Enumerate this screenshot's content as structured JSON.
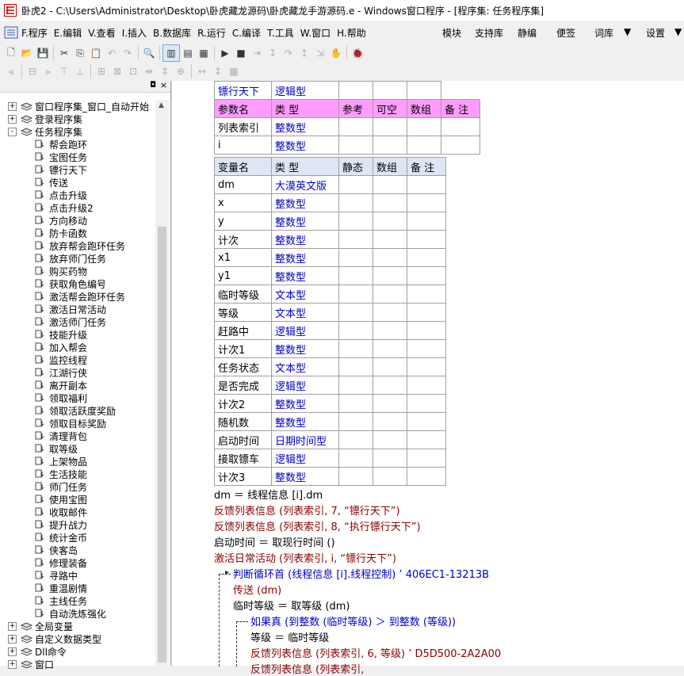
{
  "title": "卧虎2 - C:\\Users\\Administrator\\Desktop\\卧虎藏龙源码\\卧虎藏龙手游源码.e - Windows窗口程序 - [程序集: 任务程序集]",
  "menu": [
    "F.程序",
    "E.编辑",
    "V.查看",
    "I.插入",
    "B.数据库",
    "R.运行",
    "C.编译",
    "T.工具",
    "W.窗口",
    "H.帮助"
  ],
  "menu_right": [
    "模块",
    "支持库",
    "静编",
    "便签",
    "词库",
    "设置"
  ],
  "tree": [
    {
      "label": "窗口程序集_窗口_自动开始",
      "level": 1,
      "expander": "+"
    },
    {
      "label": "登录程序集",
      "level": 1,
      "expander": "+"
    },
    {
      "label": "任务程序集",
      "level": 1,
      "expander": "-"
    },
    {
      "label": "帮会跑环",
      "level": 2
    },
    {
      "label": "宝图任务",
      "level": 2
    },
    {
      "label": "镖行天下",
      "level": 2
    },
    {
      "label": "传送",
      "level": 2
    },
    {
      "label": "点击升级",
      "level": 2
    },
    {
      "label": "点击升级2",
      "level": 2
    },
    {
      "label": "方向移动",
      "level": 2
    },
    {
      "label": "防卡函数",
      "level": 2
    },
    {
      "label": "放弃帮会跑环任务",
      "level": 2
    },
    {
      "label": "放弃师门任务",
      "level": 2
    },
    {
      "label": "购买药物",
      "level": 2
    },
    {
      "label": "获取角色编号",
      "level": 2
    },
    {
      "label": "激活帮会跑环任务",
      "level": 2
    },
    {
      "label": "激活日常活动",
      "level": 2
    },
    {
      "label": "激活师门任务",
      "level": 2
    },
    {
      "label": "技能升级",
      "level": 2
    },
    {
      "label": "加入帮会",
      "level": 2
    },
    {
      "label": "监控线程",
      "level": 2
    },
    {
      "label": "江湖行侠",
      "level": 2
    },
    {
      "label": "离开副本",
      "level": 2
    },
    {
      "label": "领取福利",
      "level": 2
    },
    {
      "label": "领取活跃度奖励",
      "level": 2
    },
    {
      "label": "领取目标奖励",
      "level": 2
    },
    {
      "label": "清理背包",
      "level": 2
    },
    {
      "label": "取等级",
      "level": 2
    },
    {
      "label": "上架物品",
      "level": 2
    },
    {
      "label": "生活技能",
      "level": 2
    },
    {
      "label": "师门任务",
      "level": 2
    },
    {
      "label": "使用宝图",
      "level": 2
    },
    {
      "label": "收取邮件",
      "level": 2
    },
    {
      "label": "提升战力",
      "level": 2
    },
    {
      "label": "统计金币",
      "level": 2
    },
    {
      "label": "侠客岛",
      "level": 2
    },
    {
      "label": "修理装备",
      "level": 2
    },
    {
      "label": "寻路中",
      "level": 2
    },
    {
      "label": "重温剧情",
      "level": 2
    },
    {
      "label": "主线任务",
      "level": 2
    },
    {
      "label": "自动洗炼强化",
      "level": 2
    },
    {
      "label": "全局变量",
      "level": 0,
      "expander": "+"
    },
    {
      "label": "自定义数据类型",
      "level": 0,
      "expander": "+"
    },
    {
      "label": "Dll命令",
      "level": 0,
      "expander": "+"
    },
    {
      "label": "窗口",
      "level": 0,
      "expander": "+"
    }
  ],
  "sub_table": {
    "name": "镖行天下",
    "type": "逻辑型",
    "headers": [
      "参数名",
      "类 型",
      "参考",
      "可空",
      "数组",
      "备 注"
    ],
    "rows": [
      [
        "列表索引",
        "整数型"
      ],
      [
        "i",
        "整数型"
      ]
    ]
  },
  "var_table": {
    "headers": [
      "变量名",
      "类 型",
      "静态",
      "数组",
      "备 注"
    ],
    "rows": [
      [
        "dm",
        "大漠英文版"
      ],
      [
        "x",
        "整数型"
      ],
      [
        "y",
        "整数型"
      ],
      [
        "计次",
        "整数型"
      ],
      [
        "x1",
        "整数型"
      ],
      [
        "y1",
        "整数型"
      ],
      [
        "临时等级",
        "文本型"
      ],
      [
        "等级",
        "文本型"
      ],
      [
        "赶路中",
        "逻辑型"
      ],
      [
        "计次1",
        "整数型"
      ],
      [
        "任务状态",
        "文本型"
      ],
      [
        "是否完成",
        "逻辑型"
      ],
      [
        "计次2",
        "整数型"
      ],
      [
        "随机数",
        "整数型"
      ],
      [
        "启动时间",
        "日期时间型"
      ],
      [
        "接取镖车",
        "逻辑型"
      ],
      [
        "计次3",
        "整数型"
      ]
    ]
  },
  "code": [
    "dm ＝ 线程信息 [i].dm",
    "反馈列表信息 (列表索引, 7, “镖行天下”)",
    "反馈列表信息 (列表索引, 8, “执行镖行天下”)",
    "启动时间 ＝ 取现行时间 ()",
    "激活日常活动 (列表索引, i, “镖行天下”)",
    "判断循环首 (线程信息 [i].线程控制)  ’ 406EC1-13213B",
    "传送 (dm)",
    "临时等级 ＝ 取等级 (dm)",
    "如果真 (到整数 (临时等级) ＞ 到整数 (等级))",
    "等级 ＝ 临时等级",
    "反馈列表信息 (列表索引, 6, 等级)  ’ D5D500-2A2A00",
    "反馈列表信息 (列表索引,"
  ]
}
